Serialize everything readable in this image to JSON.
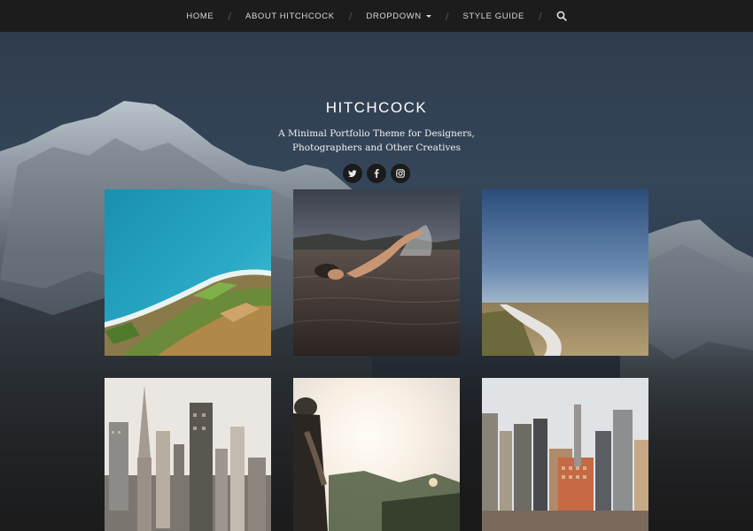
{
  "nav": {
    "items": [
      {
        "label": "HOME"
      },
      {
        "label": "ABOUT HITCHCOCK"
      },
      {
        "label": "DROPDOWN"
      },
      {
        "label": "STYLE GUIDE"
      }
    ],
    "separator": "/",
    "search_icon": "search-icon"
  },
  "header": {
    "title": "HITCHCOCK",
    "tagline_line1": "A Minimal Portfolio Theme for Designers,",
    "tagline_line2": "Photographers and Other Creatives"
  },
  "social": [
    {
      "icon": "twitter-icon"
    },
    {
      "icon": "facebook-icon"
    },
    {
      "icon": "instagram-icon"
    }
  ],
  "portfolio": [
    {
      "subject": "aerial-coastline"
    },
    {
      "subject": "swimmer"
    },
    {
      "subject": "country-road"
    },
    {
      "subject": "city-skyline"
    },
    {
      "subject": "sunlit-person"
    },
    {
      "subject": "city-buildings"
    }
  ],
  "colors": {
    "nav_bg": "#1c1c1c",
    "nav_text": "#d8d8d8",
    "title": "#ffffff",
    "social_bg": "#1b1b1b"
  }
}
